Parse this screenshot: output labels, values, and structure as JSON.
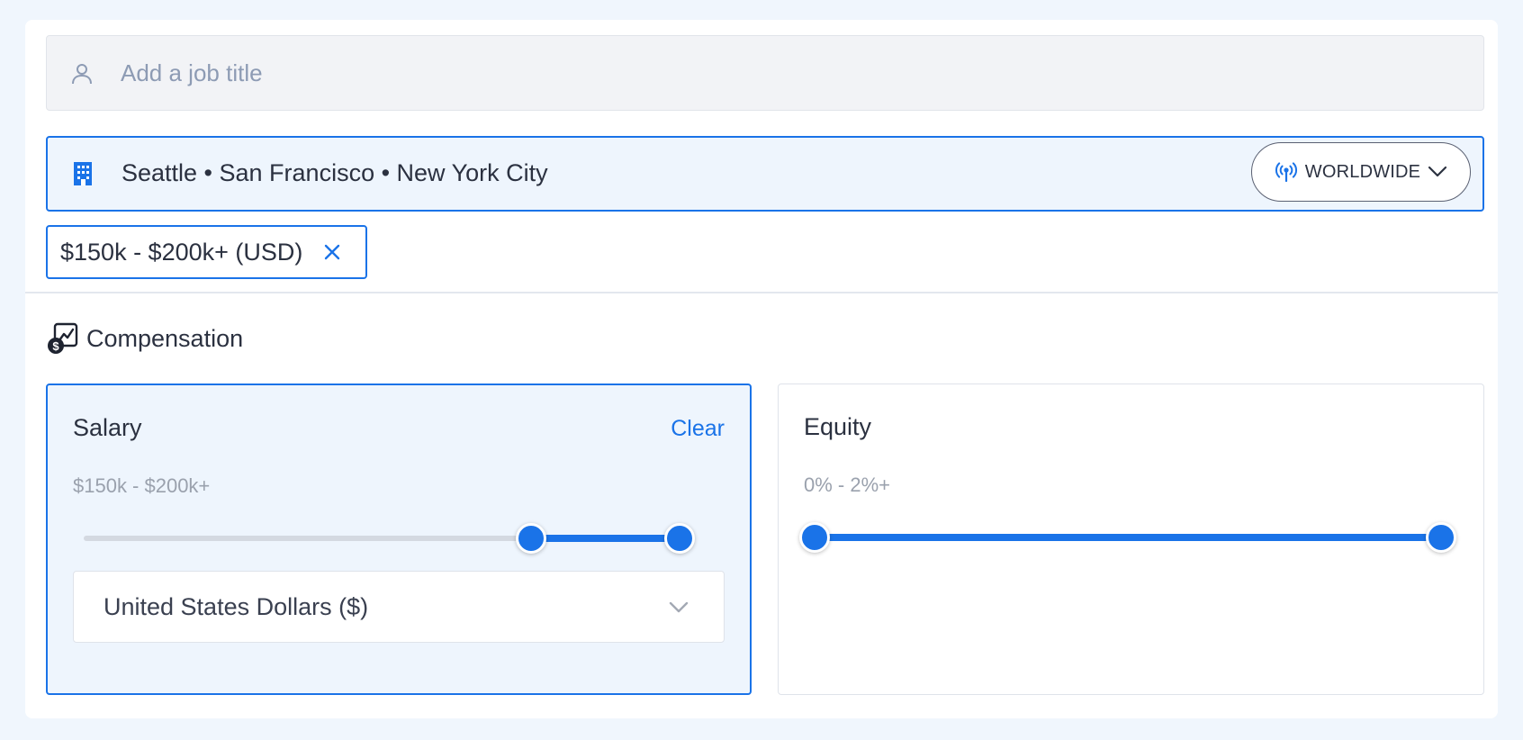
{
  "job_title": {
    "placeholder": "Add a job title",
    "value": "",
    "icon": "person-icon"
  },
  "location": {
    "text": "Seattle • San Francisco • New York City",
    "icon": "building-icon",
    "worldwide_button": {
      "label": "WORLDWIDE",
      "icon": "broadcast-icon",
      "chevron": "chevron-down-icon"
    }
  },
  "filter_chip": {
    "label": "$150k - $200k+ (USD)",
    "remove_icon": "close-icon"
  },
  "compensation": {
    "heading": "Compensation",
    "icon": "compensation-icon",
    "salary": {
      "title": "Salary",
      "clear_label": "Clear",
      "range_text": "$150k - $200k+",
      "slider": {
        "min_fraction": 0.75,
        "max_fraction": 1.0
      },
      "currency_select": {
        "selected": "United States Dollars ($)"
      }
    },
    "equity": {
      "title": "Equity",
      "range_text": "0% - 2%+",
      "slider": {
        "min_fraction": 0.0,
        "max_fraction": 1.0
      }
    }
  },
  "colors": {
    "accent": "#1a73e8",
    "panel_active_bg": "#eef5fd",
    "track": "#d4d9e1",
    "page_bg": "#f0f6fd"
  }
}
